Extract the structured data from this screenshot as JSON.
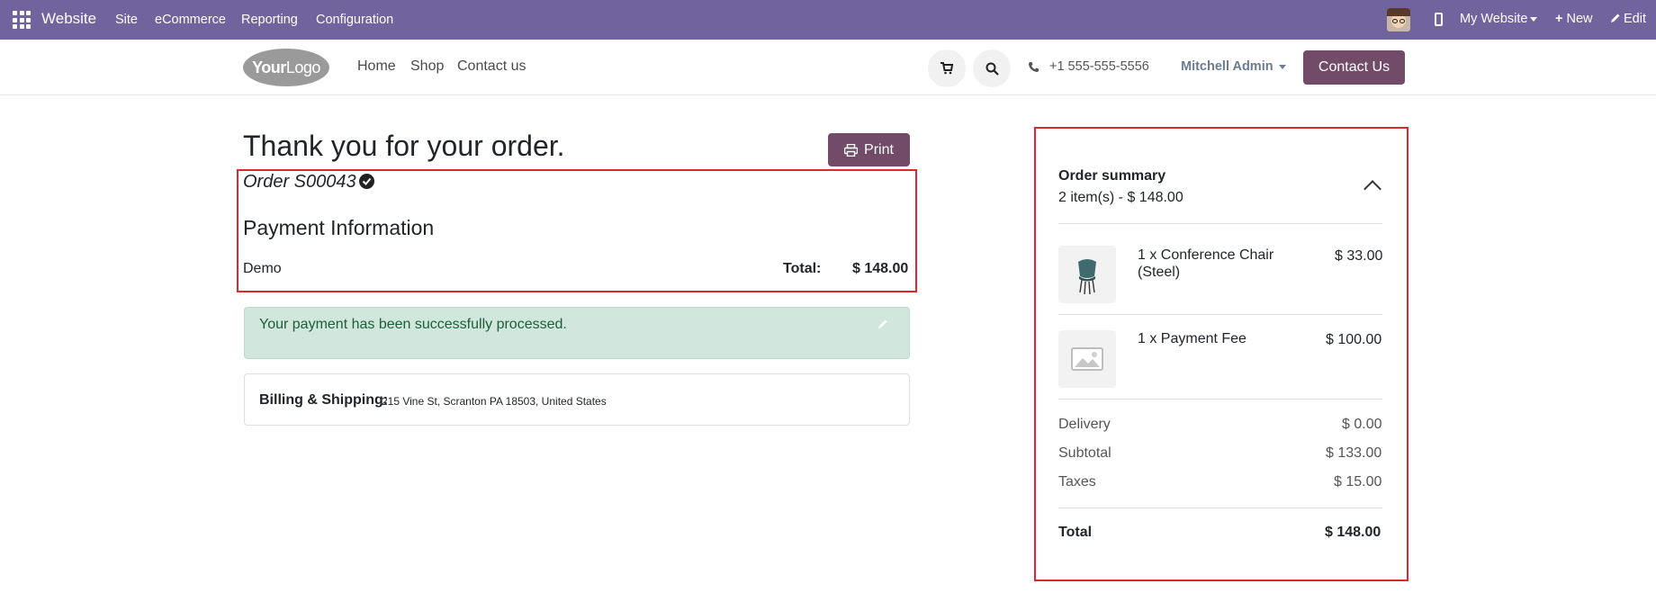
{
  "admin_bar": {
    "brand": "Website",
    "menu": [
      "Site",
      "eCommerce",
      "Reporting",
      "Configuration"
    ],
    "website_selector": "My Website",
    "new_label": "New",
    "edit_label": "Edit",
    "color": "#71639e"
  },
  "navbar": {
    "logo_text_bold": "Your",
    "logo_text_light": "Logo",
    "links": [
      "Home",
      "Shop",
      "Contact us"
    ],
    "phone": "+1 555-555-5556",
    "user": "Mitchell Admin",
    "contact_button": "Contact Us",
    "accent": "#714b67"
  },
  "confirmation": {
    "title": "Thank you for your order.",
    "print_label": "Print",
    "order_number": "Order S00043",
    "payment_title": "Payment Information",
    "payment_method": "Demo",
    "total_label": "Total:",
    "total_value": "$ 148.00"
  },
  "alert": {
    "message": "Your payment has been successfully processed."
  },
  "billing": {
    "label": "Billing & Shipping:",
    "address": "215 Vine St, Scranton PA 18503, United States"
  },
  "summary": {
    "title": "Order summary",
    "subtitle": "2 item(s) -  $ 148.00",
    "items": [
      {
        "name": "1 x Conference Chair (Steel)",
        "price": "$ 33.00",
        "icon": "chair-image"
      },
      {
        "name": "1 x Payment Fee",
        "price": "$ 100.00",
        "icon": "image-placeholder"
      }
    ],
    "lines": [
      {
        "label": "Delivery",
        "value": "$ 0.00"
      },
      {
        "label": "Subtotal",
        "value": "$ 133.00"
      },
      {
        "label": "Taxes",
        "value": "$ 15.00"
      }
    ],
    "total_label": "Total",
    "total_value": "$ 148.00"
  },
  "highlight_color": "#e0262e"
}
